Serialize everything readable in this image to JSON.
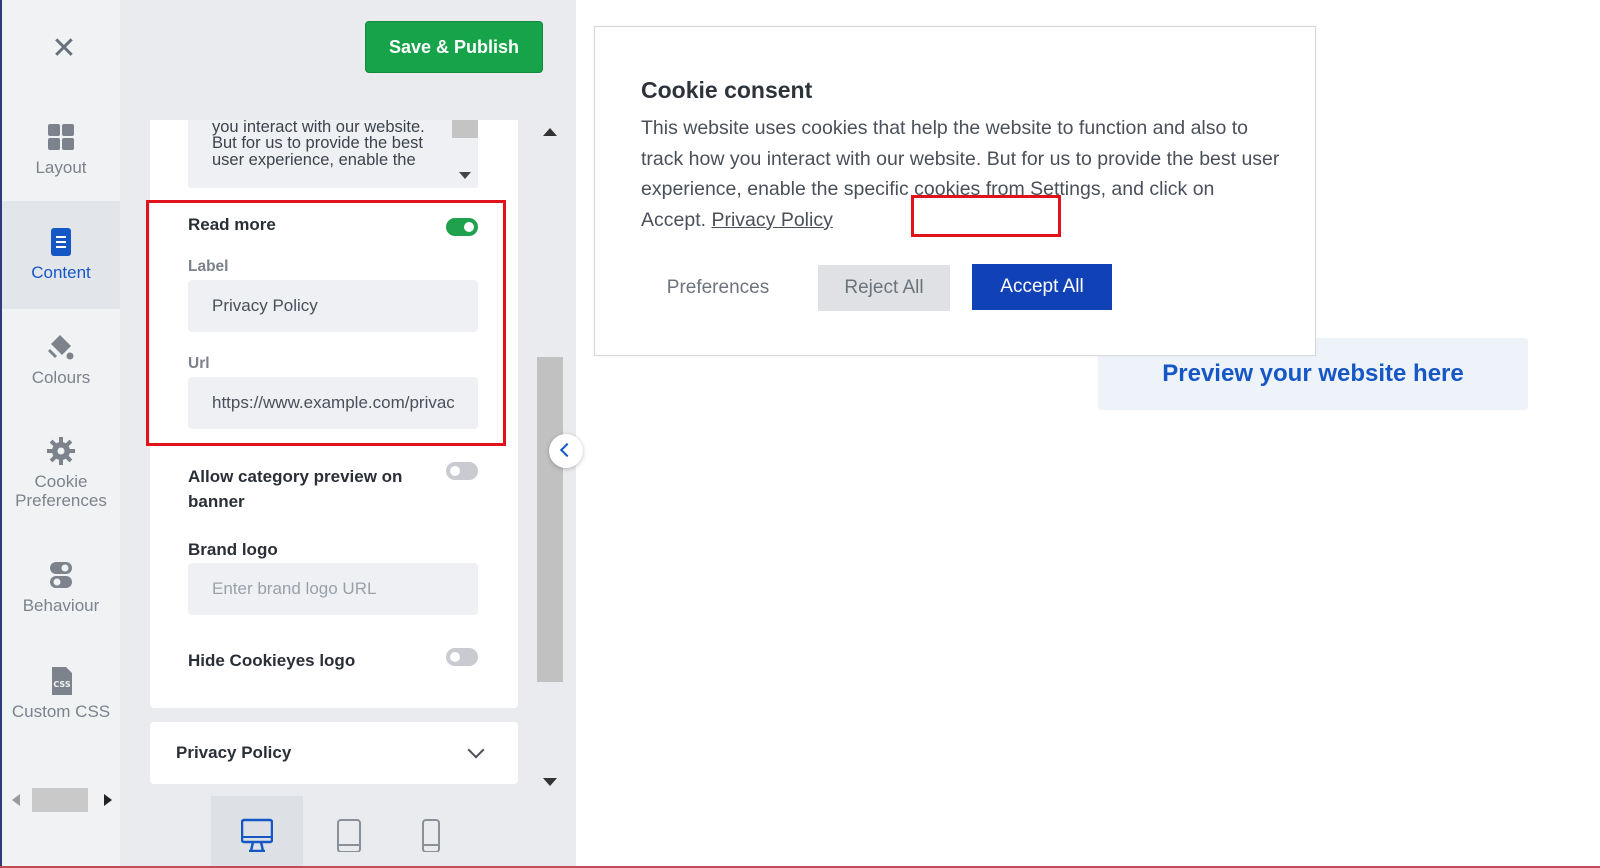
{
  "rail": {
    "close_icon": "close-icon",
    "items": [
      {
        "label": "Layout",
        "icon": "grid-icon",
        "active": false
      },
      {
        "label": "Content",
        "icon": "document-icon",
        "active": true
      },
      {
        "label": "Colours",
        "icon": "paint-bucket-icon",
        "active": false
      },
      {
        "label": "Cookie Preferences",
        "icon": "gear-icon",
        "active": false
      },
      {
        "label": "Behaviour",
        "icon": "toggles-icon",
        "active": false
      },
      {
        "label": "Custom CSS",
        "icon": "css-file-icon",
        "active": false
      }
    ],
    "active_color": "#1657c6"
  },
  "toolbar": {
    "save_label": "Save & Publish",
    "save_color": "#16a34a"
  },
  "content": {
    "description_snippet": "function and also to track how you interact with our website. But for us to provide the best user experience, enable the",
    "read_more": {
      "label": "Read more",
      "enabled": true,
      "label_field_title": "Label",
      "label_value": "Privacy Policy",
      "url_field_title": "Url",
      "url_value": "https://www.example.com/privacy-policy"
    },
    "category_preview": {
      "label": "Allow category preview on banner",
      "enabled": false
    },
    "brand_logo": {
      "label": "Brand logo",
      "placeholder": "Enter brand logo URL",
      "value": ""
    },
    "hide_logo": {
      "label": "Hide Cookieyes logo",
      "enabled": false
    },
    "privacy_section": {
      "title": "Privacy Policy",
      "icon": "chevron-down-icon"
    }
  },
  "devices": [
    {
      "name": "desktop-icon",
      "active": true
    },
    {
      "name": "tablet-icon",
      "active": false
    },
    {
      "name": "mobile-icon",
      "active": false
    }
  ],
  "preview": {
    "label": "Preview your website here",
    "banner": {
      "title": "Cookie consent",
      "text": "This website uses cookies that help the website to function and also to track how you interact with our website. But for us to provide the best user experience, enable the specific cookies from Settings, and click on Accept.",
      "link_text": "Privacy Policy",
      "preferences_label": "Preferences",
      "reject_label": "Reject All",
      "accept_label": "Accept All",
      "accept_color": "#1141b6"
    }
  }
}
